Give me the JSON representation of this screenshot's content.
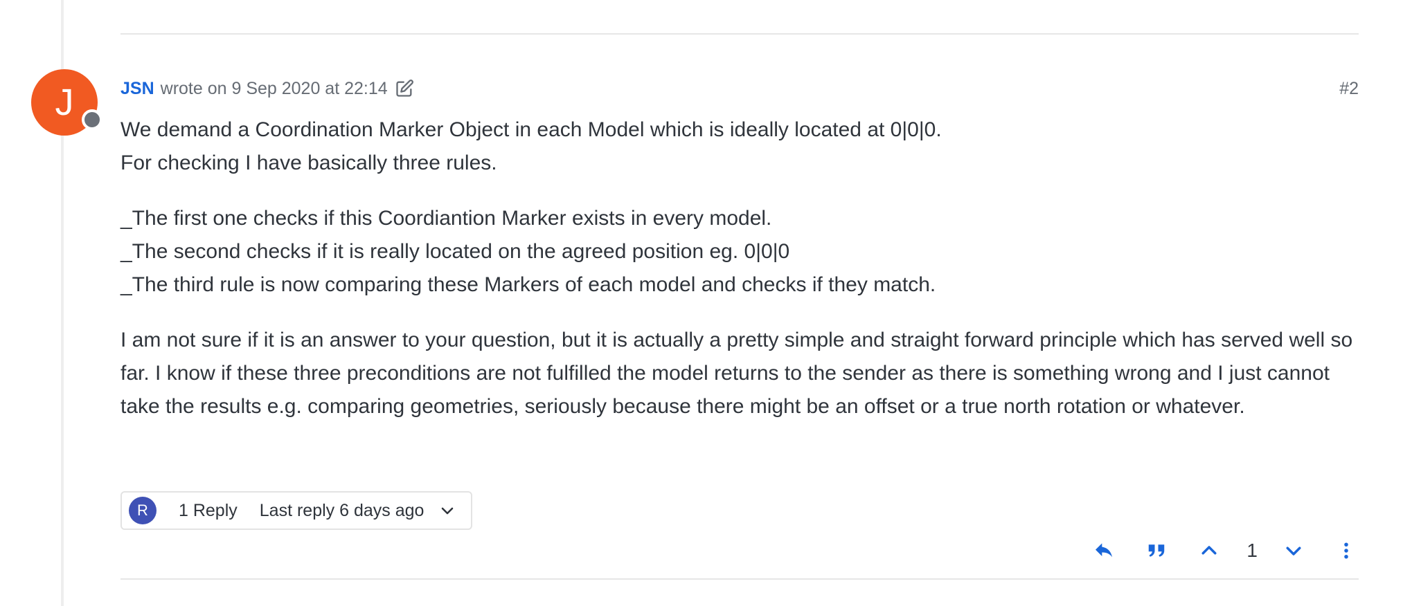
{
  "colors": {
    "accent": "#1a66d9",
    "avatar_bg": "#f15a22",
    "reply_avatar_bg": "#3f51b5",
    "status_offline": "#6b7078"
  },
  "post": {
    "author_initial": "J",
    "author": "JSN",
    "wrote_on": "wrote on 9 Sep 2020 at 22:14",
    "index": "#2",
    "paragraphs": [
      [
        "We demand a Coordination Marker Object in each Model which is ideally located at 0|0|0.",
        "For checking I have basically three rules."
      ],
      [
        "_The first one checks if this Coordiantion Marker exists in every model.",
        "_The second checks if it is really located on the agreed position eg. 0|0|0",
        "_The third rule is now comparing these Markers of each model and checks if they match."
      ],
      [
        "I am not sure if it is an answer to your question, but it is actually a pretty simple and straight forward principle which has served well so far. I know if these three preconditions are not fulfilled the model returns to the sender as there is something wrong and I just cannot take the results e.g. comparing geometries, seriously because there might be an offset or a true north rotation or whatever."
      ]
    ]
  },
  "replies": {
    "avatar_initial": "R",
    "count_label": "1 Reply",
    "last_reply_label": "Last reply 6 days ago"
  },
  "actions": {
    "vote_count": "1",
    "icons": [
      "reply-icon",
      "quote-icon",
      "upvote-icon",
      "downvote-icon",
      "more-options-icon"
    ]
  }
}
